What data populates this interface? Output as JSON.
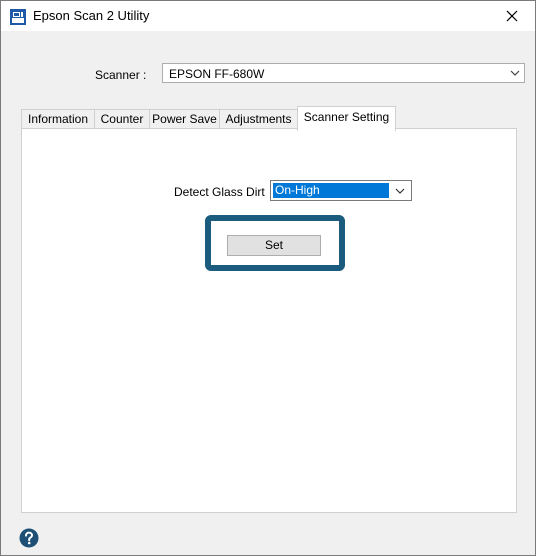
{
  "window": {
    "title": "Epson Scan 2 Utility",
    "close_icon": "close-icon",
    "app_icon": "epson-scan-app-icon"
  },
  "scanner": {
    "label": "Scanner :",
    "selected": "EPSON FF-680W"
  },
  "tabs": [
    {
      "label": "Information",
      "active": false
    },
    {
      "label": "Counter",
      "active": false
    },
    {
      "label": "Power Save",
      "active": false
    },
    {
      "label": "Adjustments",
      "active": false
    },
    {
      "label": "Scanner Setting",
      "active": true
    }
  ],
  "scanner_setting": {
    "detect_glass_dirt_label": "Detect Glass Dirt",
    "detect_glass_dirt_value": "On-High",
    "set_label": "Set"
  },
  "footer": {
    "help_icon": "help-icon"
  },
  "colors": {
    "highlight_border": "#1b5b7e",
    "selection": "#0078d7",
    "help_icon": "#1e4f74"
  }
}
